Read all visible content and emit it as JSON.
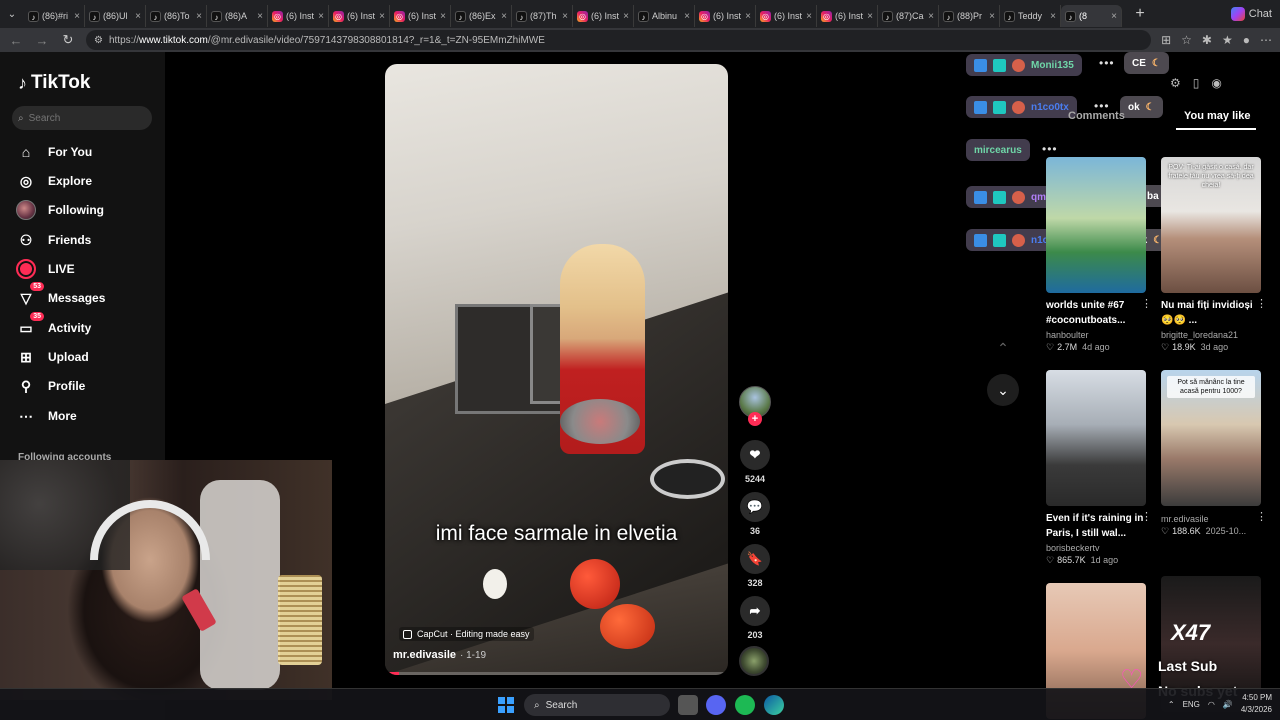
{
  "browser": {
    "tabs": [
      {
        "label": "(86)#ri",
        "icon": "tiktok-icon"
      },
      {
        "label": "(86)Ul",
        "icon": "tiktok-icon"
      },
      {
        "label": "(86)To",
        "icon": "tiktok-icon"
      },
      {
        "label": "(86)A",
        "icon": "tiktok-icon"
      },
      {
        "label": "(6) Inst",
        "icon": "instagram-icon"
      },
      {
        "label": "(6) Inst",
        "icon": "instagram-icon"
      },
      {
        "label": "(6) Inst",
        "icon": "instagram-icon"
      },
      {
        "label": "(86)Ex",
        "icon": "tiktok-icon"
      },
      {
        "label": "(87)Th",
        "icon": "tiktok-icon"
      },
      {
        "label": "(6) Inst",
        "icon": "instagram-icon"
      },
      {
        "label": "Albinu",
        "icon": "tiktok-icon"
      },
      {
        "label": "(6) Inst",
        "icon": "instagram-icon"
      },
      {
        "label": "(6) Inst",
        "icon": "instagram-icon"
      },
      {
        "label": "(6) Inst",
        "icon": "instagram-icon"
      },
      {
        "label": "(87)Ca",
        "icon": "tiktok-icon"
      },
      {
        "label": "(88)Pr",
        "icon": "tiktok-icon"
      },
      {
        "label": "Teddy",
        "icon": "tiktok-icon"
      },
      {
        "label": "(8",
        "icon": "tiktok-icon",
        "active": true
      }
    ],
    "new_tab": "+",
    "chat_label": "Chat",
    "url_scheme": "https://",
    "url_host": "www.tiktok.com",
    "url_path": "/@mr.edivasile/video/7597143798308801814?_r=1&_t=ZN-95EMmZhiMWE"
  },
  "sidebar": {
    "brand": "TikTok",
    "search_placeholder": "Search",
    "nav": [
      {
        "label": "For You",
        "icon": "home-icon"
      },
      {
        "label": "Explore",
        "icon": "compass-icon"
      },
      {
        "label": "Following",
        "icon": "avatar-icon"
      },
      {
        "label": "Friends",
        "icon": "friends-icon"
      },
      {
        "label": "LIVE",
        "icon": "live-icon"
      },
      {
        "label": "Messages",
        "icon": "messages-icon",
        "badge": "53"
      },
      {
        "label": "Activity",
        "icon": "activity-icon",
        "badge": "35"
      },
      {
        "label": "Upload",
        "icon": "upload-icon"
      },
      {
        "label": "Profile",
        "icon": "profile-icon"
      },
      {
        "label": "More",
        "icon": "more-icon"
      }
    ],
    "following_accounts": "Following accounts"
  },
  "video": {
    "caption": "imi face sarmale in elvetia",
    "capcut": "CapCut · Editing made easy",
    "author": "mr.edivasile",
    "date": "· 1-19",
    "progress": 0.04
  },
  "actions": {
    "likes": "5244",
    "comments": "36",
    "saves": "328",
    "shares": "203"
  },
  "chat": {
    "rows": [
      {
        "name": "Monii135",
        "style": "teal"
      },
      {
        "name": "n1co0tx",
        "style": "blue"
      },
      {
        "name": "mircearus",
        "style": "teal"
      },
      {
        "name": "qmihai0_ox",
        "style": "purple"
      },
      {
        "name": "n1co0tx",
        "style": "blue"
      }
    ],
    "messages": [
      "CE",
      "ok",
      "ba",
      "okk"
    ]
  },
  "panel": {
    "tab_comments": "Comments",
    "tab_you_may_like": "You may like",
    "cards": [
      {
        "title": "worlds unite #67 #coconutboats...",
        "user": "hanboulter",
        "likes": "2.7M",
        "ago": "4d ago",
        "thumb_text": ""
      },
      {
        "title": "Nu mai fiți invidioși 🥺🥺 ...",
        "user": "brigitte_loredana21",
        "likes": "18.9K",
        "ago": "3d ago",
        "thumb_text": "POV: Ți-ai găsit o casă, dar fratele tău nu vrea să-ți dea cheia!"
      },
      {
        "title": "Even if it's raining in Paris, I still wal...",
        "user": "borisbeckertv",
        "likes": "865.7K",
        "ago": "1d ago",
        "thumb_text": ""
      },
      {
        "title": "",
        "user": "mr.edivasile",
        "likes": "188.6K",
        "ago": "2025-10...",
        "thumb_text": "Pot să mănânc la tine acasă pentru 1000?"
      },
      {
        "title": "",
        "user": "",
        "likes": "",
        "ago": "",
        "thumb_text": ""
      },
      {
        "title": "",
        "user": "",
        "likes": "",
        "ago": "",
        "thumb_text": "X47"
      }
    ]
  },
  "overlay": {
    "last_sub": "Last Sub",
    "no_subs": "No subs yet"
  },
  "taskbar": {
    "search": "Search",
    "lang": "ENG",
    "time": "4:50 PM",
    "date": "4/3/2026"
  }
}
